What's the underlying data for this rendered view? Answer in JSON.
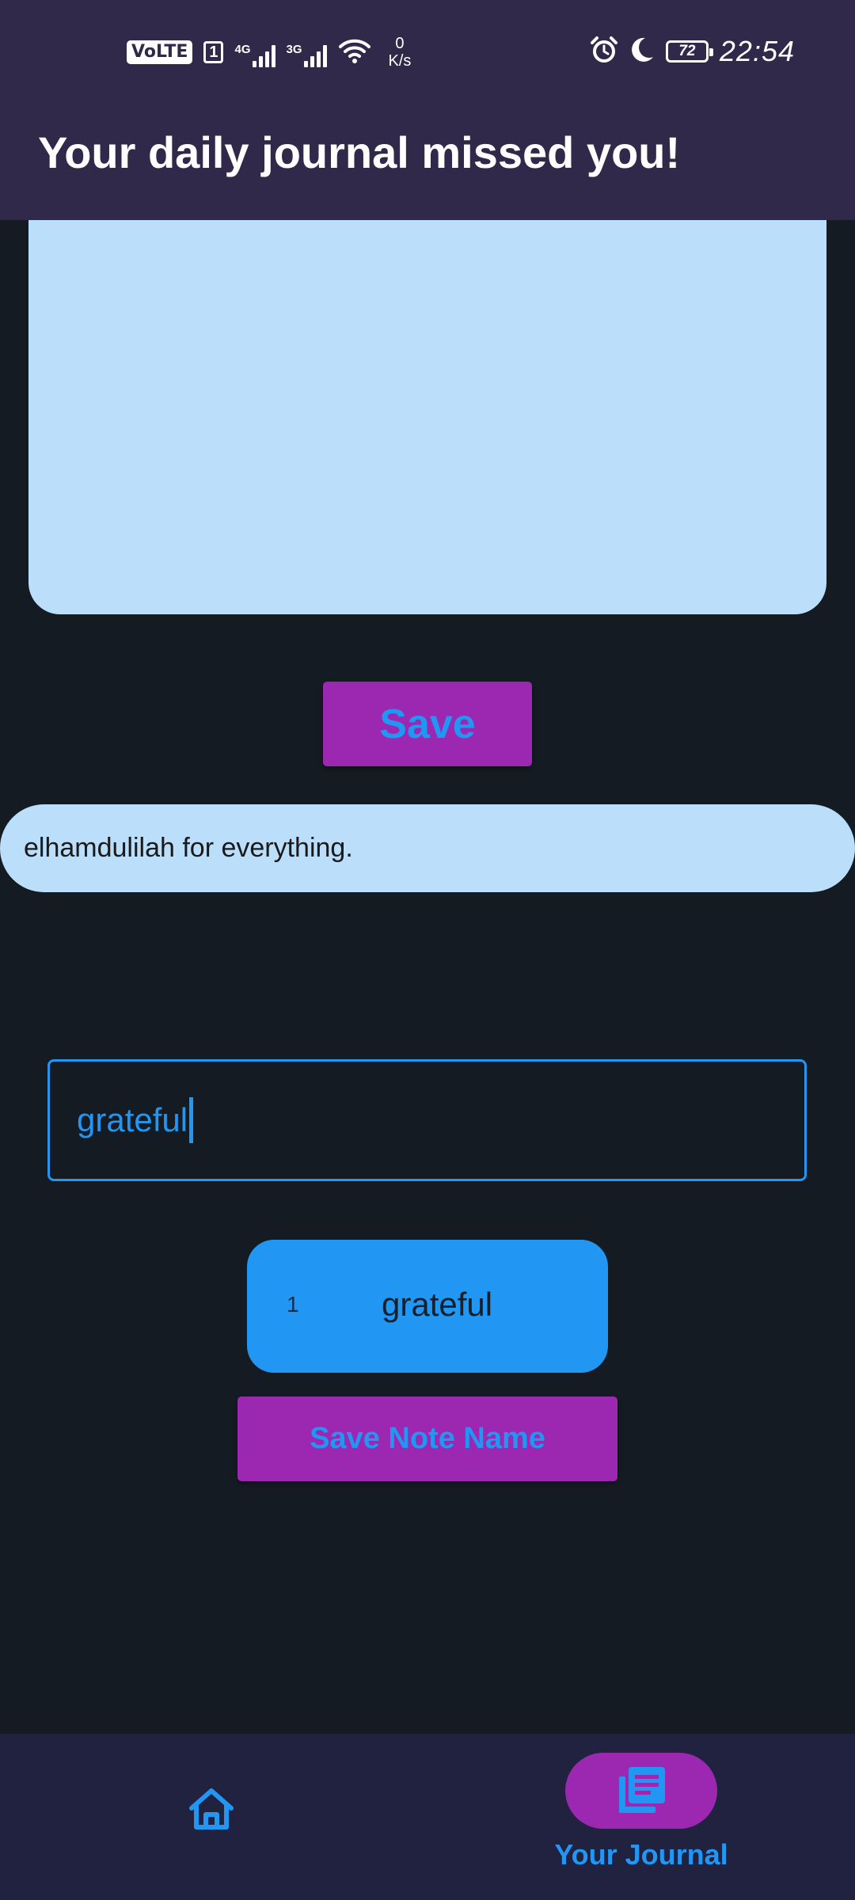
{
  "status_bar": {
    "volte_label": "VoLTE",
    "sim_label": "1",
    "network_1": "4G",
    "network_2": "3G",
    "speed_value": "0",
    "speed_unit": "K/s",
    "battery_level": "72",
    "time": "22:54",
    "icons": [
      "alarm-icon",
      "moon-icon",
      "battery-icon",
      "wifi-icon",
      "signal-icon"
    ]
  },
  "app_bar": {
    "title": "Your daily journal missed you!"
  },
  "journal": {
    "save_label": "Save"
  },
  "entries": [
    {
      "text": "elhamdulilah for everything."
    }
  ],
  "note_name": {
    "value": "grateful"
  },
  "tags": [
    {
      "index": "1",
      "name": "grateful"
    }
  ],
  "note_actions": {
    "save_note_name_label": "Save Note Name"
  },
  "bottom_nav": {
    "items": [
      {
        "icon": "home-icon",
        "label": ""
      },
      {
        "icon": "journal-icon",
        "label": "Your Journal",
        "selected": true
      }
    ]
  },
  "colors": {
    "app_bar": "#30294a",
    "background": "#141b23",
    "card": "#bbdefb",
    "accent_purple": "#9c27b0",
    "accent_blue": "#2196f3",
    "nav_bar": "#212140"
  }
}
